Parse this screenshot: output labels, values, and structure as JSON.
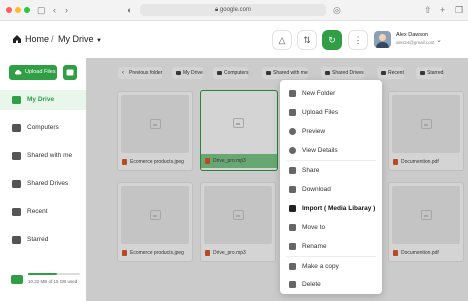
{
  "browser": {
    "url": "google.com"
  },
  "header": {
    "breadcrumb_home": "Home",
    "breadcrumb_current": "My Drive",
    "user_name": "Alex Dawson",
    "user_email": "alex24@gmail.com"
  },
  "sidebar": {
    "upload_label": "Upload Files",
    "items": [
      {
        "label": "My Drive",
        "icon": "drive-icon",
        "active": true
      },
      {
        "label": "Computers",
        "icon": "computer-icon"
      },
      {
        "label": "Shared with me",
        "icon": "shared-icon"
      },
      {
        "label": "Shared Drives",
        "icon": "shared-drive-icon"
      },
      {
        "label": "Recent",
        "icon": "clock-icon"
      },
      {
        "label": "Starred",
        "icon": "star-icon"
      }
    ],
    "storage_text": "10.22 MB of 15 GB used",
    "storage_fraction": 0.55
  },
  "toolbar": {
    "items": [
      "Previous folder",
      "My Drive",
      "Computers",
      "Shared with me",
      "Shared Drives",
      "Recent",
      "Starred"
    ]
  },
  "files": {
    "row1": [
      "Ecomerce products.jpeg",
      "Drive_pro.mp3",
      "",
      "Documention.pdf"
    ],
    "row2": [
      "Ecomerce products.jpeg",
      "Drive_pro.mp3",
      "",
      "Documention.pdf"
    ]
  },
  "context_menu": {
    "items": [
      "New Folder",
      "Upload Files",
      "Preview",
      "View Details",
      "Share",
      "Download",
      "Import ( Media Libaray )",
      "Move to",
      "Rename",
      "Make a copy",
      "Delete"
    ]
  },
  "colors": {
    "accent": "#2f9e44",
    "selected_bg": "#e9f6ec"
  }
}
